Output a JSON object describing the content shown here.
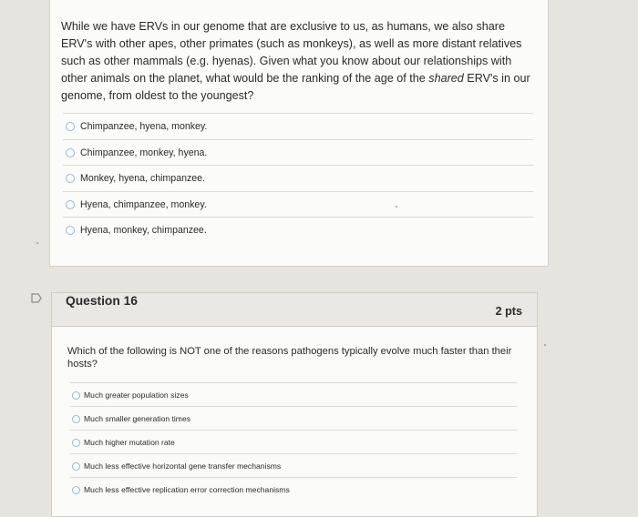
{
  "question15": {
    "text_before": "While we have ERVs in our genome that are exclusive to us, as humans, we also share ERV's with other apes, other primates (such as monkeys), as well as more distant relatives such as other mammals (e.g. hyenas). Given what you know about our relationships with other animals on the planet, what would be the ranking of the age of the ",
    "text_em": "shared",
    "text_after": " ERV's in our genome, from oldest to the youngest?",
    "options": [
      "Chimpanzee, hyena, monkey.",
      "Chimpanzee, monkey, hyena.",
      "Monkey, hyena, chimpanzee.",
      "Hyena, chimpanzee, monkey.",
      "Hyena, monkey, chimpanzee."
    ]
  },
  "question16": {
    "title": "Question 16",
    "points": "2 pts",
    "text": "Which of the following is NOT one of the reasons pathogens typically evolve much faster than their hosts?",
    "options": [
      "Much greater population sizes",
      "Much smaller generation times",
      "Much higher mutation rate",
      "Much less effective horizontal gene transfer mechanisms",
      "Much less effective replication error correction mechanisms"
    ]
  },
  "icons": {
    "flag": "flag-outline-icon",
    "radio": "radio-button-icon"
  },
  "colors": {
    "page_bg": "#e6e4df",
    "card_bg": "#fbfbfa",
    "header_bg": "#e9e8e4",
    "radio_border": "#9bb5cf"
  }
}
